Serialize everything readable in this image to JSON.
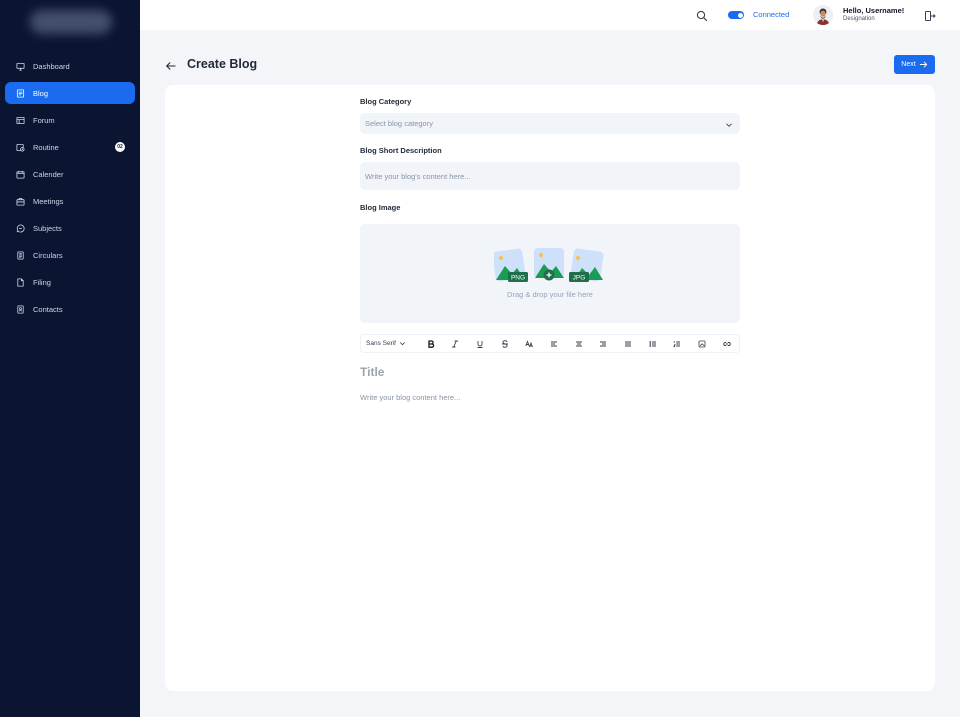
{
  "sidebar": {
    "items": [
      {
        "label": "Dashboard",
        "icon": "monitor-icon"
      },
      {
        "label": "Blog",
        "icon": "blog-icon",
        "active": true
      },
      {
        "label": "Forum",
        "icon": "forum-icon"
      },
      {
        "label": "Routine",
        "icon": "routine-icon",
        "badge": "02"
      },
      {
        "label": "Calender",
        "icon": "calendar-icon"
      },
      {
        "label": "Meetings",
        "icon": "meetings-icon"
      },
      {
        "label": "Subjects",
        "icon": "subjects-icon"
      },
      {
        "label": "Circulars",
        "icon": "circulars-icon"
      },
      {
        "label": "Filing",
        "icon": "file-icon"
      },
      {
        "label": "Contacts",
        "icon": "contacts-icon"
      }
    ]
  },
  "topbar": {
    "status": "Connected",
    "greeting": "Hello, Username!",
    "designation": "Designation"
  },
  "header": {
    "title": "Create Blog",
    "next_label": "Next"
  },
  "form": {
    "category_label": "Blog Category",
    "category_placeholder": "Select blog category",
    "description_label": "Blog Short Description",
    "description_placeholder": "Write your blog's content here...",
    "image_label": "Blog Image",
    "dropzone_text": "Drag & drop your file here",
    "png_tag": "PNG",
    "jpg_tag": "JPG"
  },
  "editor": {
    "font": "Sans Serif",
    "title_placeholder": "Title",
    "body_placeholder": "Write your blog content here..."
  },
  "colors": {
    "sidebar_bg": "#0b1532",
    "accent": "#1a6bf0",
    "page_bg": "#f3f5f9"
  }
}
